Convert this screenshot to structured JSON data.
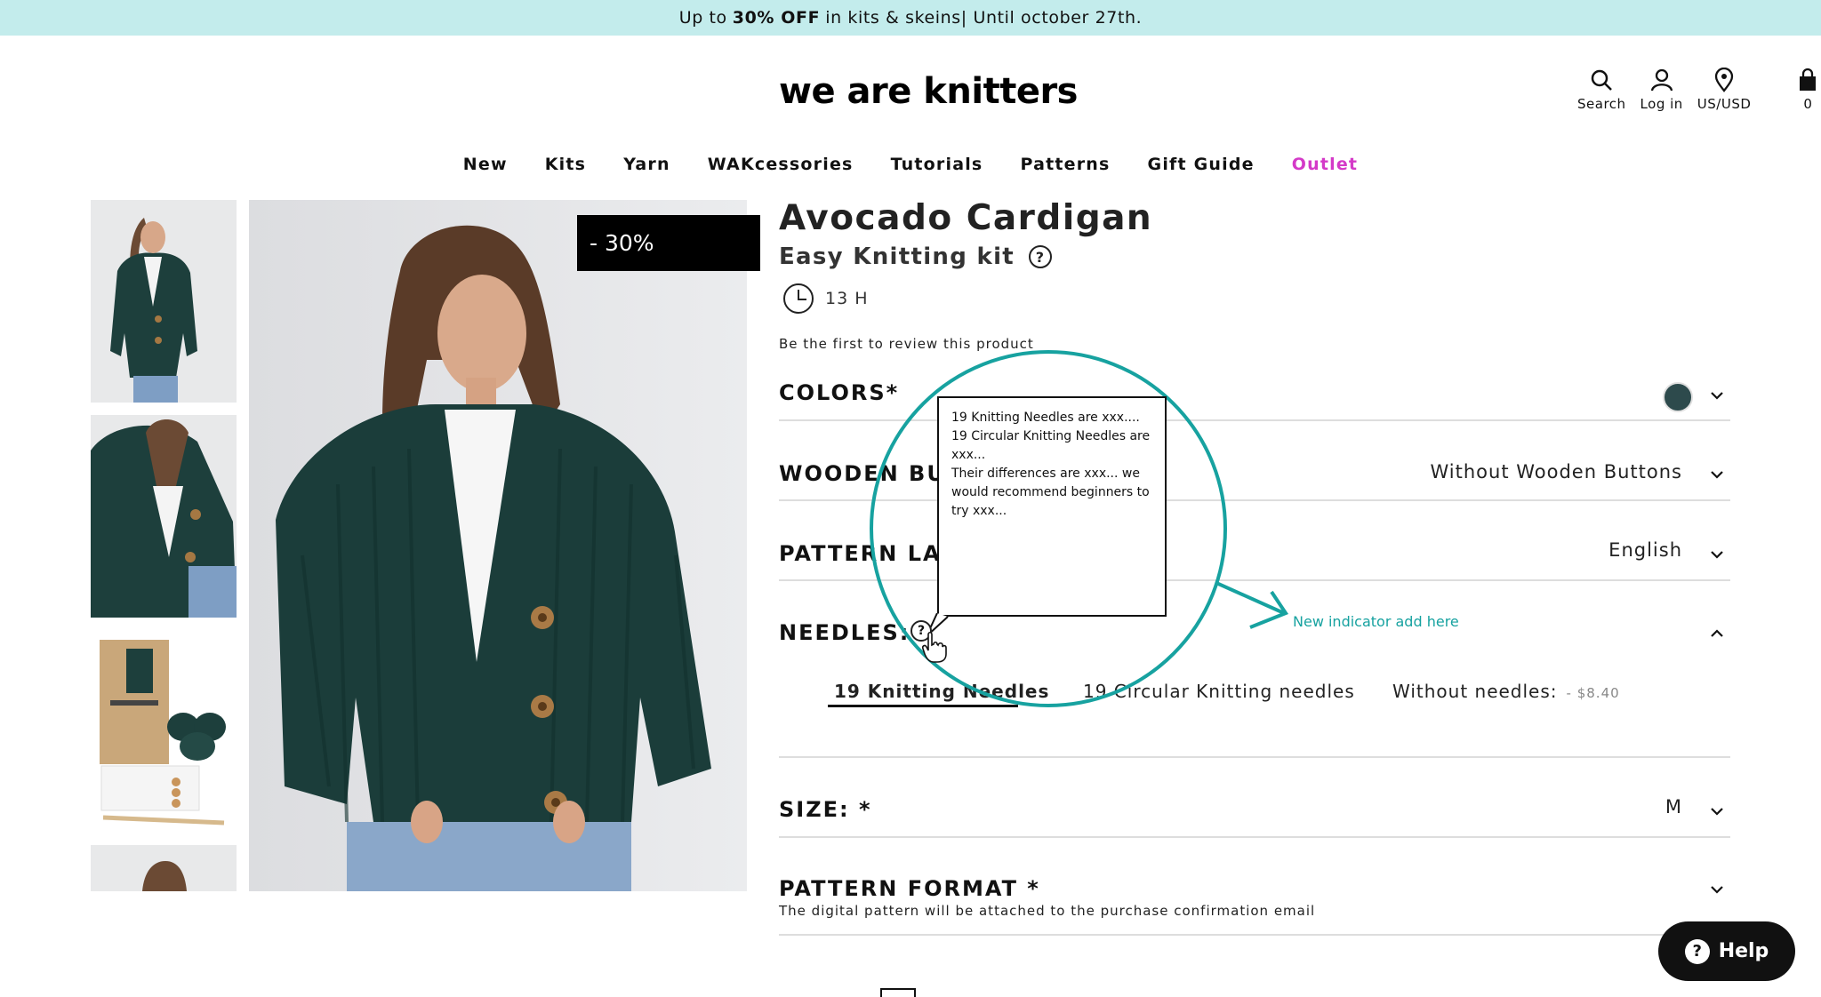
{
  "promo": {
    "prefix": "Up to",
    "highlight": "30% OFF",
    "suffix": "in kits & skeins| Until october 27th."
  },
  "brand": {
    "logo": "we are knitters"
  },
  "header_icons": [
    {
      "label": "Search",
      "icon": "search-icon"
    },
    {
      "label": "Log in",
      "icon": "user-icon"
    },
    {
      "label": "US/USD",
      "icon": "location-pin-icon"
    },
    {
      "label": "0",
      "icon": "shopping-bag-icon"
    }
  ],
  "nav": {
    "items": [
      "New",
      "Kits",
      "Yarn",
      "WAKcessories",
      "Tutorials",
      "Patterns",
      "Gift Guide",
      "Outlet"
    ],
    "outlet_color": "#d43ac8"
  },
  "gallery": {
    "discount_badge": "- 30%",
    "thumbnail_count": 4
  },
  "product": {
    "title": "Avocado Cardigan",
    "subtitle": "Easy Knitting kit",
    "time": "13 H",
    "review_link": "Be the first to review this product"
  },
  "options": {
    "colors": {
      "label": "COLORS*",
      "swatch": "#2d4a4c"
    },
    "wooden_buttons": {
      "label": "WOODEN BUTT",
      "value": "Without Wooden Buttons"
    },
    "pattern_language": {
      "label": "PATTERN LANG",
      "value": "English"
    },
    "needles": {
      "label": "NEEDLES: *",
      "choices": [
        {
          "label": "19 Knitting Needles",
          "active": true
        },
        {
          "label": "19 Circular Knitting needles",
          "active": false
        },
        {
          "label": "Without needles:",
          "price": "- $8.40",
          "active": false
        }
      ]
    },
    "size": {
      "label": "SIZE: *",
      "value": "M"
    },
    "pattern_format": {
      "label": "PATTERN FORMAT *",
      "note": "The digital pattern will be attached to the purchase confirmation email"
    }
  },
  "annotation": {
    "tooltip_line1": "19 Knitting Needles are xxx....",
    "tooltip_line2": "19 Circular Knitting Needles are xxx...",
    "tooltip_line3": "Their differences are xxx... we would recommend beginners to try xxx...",
    "indicator_text": "New indicator add here",
    "accent_color": "#17a2a0"
  },
  "help_widget": {
    "label": "Help"
  }
}
